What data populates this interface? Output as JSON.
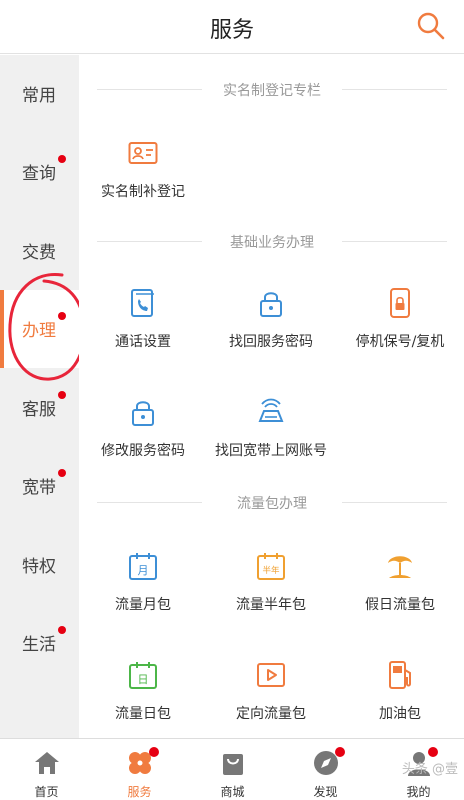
{
  "header": {
    "title": "服务",
    "search_icon": "search-icon",
    "accent": "#f07b3f"
  },
  "sidebar": {
    "items": [
      {
        "label": "常用",
        "badge": false
      },
      {
        "label": "查询",
        "badge": true
      },
      {
        "label": "交费",
        "badge": false
      },
      {
        "label": "办理",
        "badge": true,
        "active": true
      },
      {
        "label": "客服",
        "badge": true
      },
      {
        "label": "宽带",
        "badge": true
      },
      {
        "label": "特权",
        "badge": false
      },
      {
        "label": "生活",
        "badge": true
      }
    ]
  },
  "sections": [
    {
      "title": "实名制登记专栏",
      "items": [
        {
          "label": "实名制补登记",
          "icon": "id-card-icon"
        }
      ]
    },
    {
      "title": "基础业务办理",
      "items": [
        {
          "label": "通话设置",
          "icon": "call-settings-icon"
        },
        {
          "label": "找回服务密码",
          "icon": "lock-icon"
        },
        {
          "label": "停机保号/复机",
          "icon": "phone-lock-icon"
        },
        {
          "label": "修改服务密码",
          "icon": "lock-icon"
        },
        {
          "label": "找回宽带上网账号",
          "icon": "router-icon"
        }
      ]
    },
    {
      "title": "流量包办理",
      "items": [
        {
          "label": "流量月包",
          "icon": "calendar-month-icon",
          "icon_text": "月"
        },
        {
          "label": "流量半年包",
          "icon": "calendar-half-year-icon",
          "icon_text": "半年"
        },
        {
          "label": "假日流量包",
          "icon": "beach-umbrella-icon"
        },
        {
          "label": "流量日包",
          "icon": "calendar-day-icon",
          "icon_text": "日"
        },
        {
          "label": "定向流量包",
          "icon": "play-icon"
        },
        {
          "label": "加油包",
          "icon": "fuel-icon"
        }
      ]
    }
  ],
  "tabbar": {
    "items": [
      {
        "label": "首页",
        "icon": "home-icon",
        "badge": false
      },
      {
        "label": "服务",
        "icon": "service-icon",
        "badge": true,
        "active": true
      },
      {
        "label": "商城",
        "icon": "shopping-bag-icon",
        "badge": false
      },
      {
        "label": "发现",
        "icon": "discover-icon",
        "badge": true
      },
      {
        "label": "我的",
        "icon": "user-icon",
        "badge": true
      }
    ],
    "watermark": "头条 @壹"
  }
}
